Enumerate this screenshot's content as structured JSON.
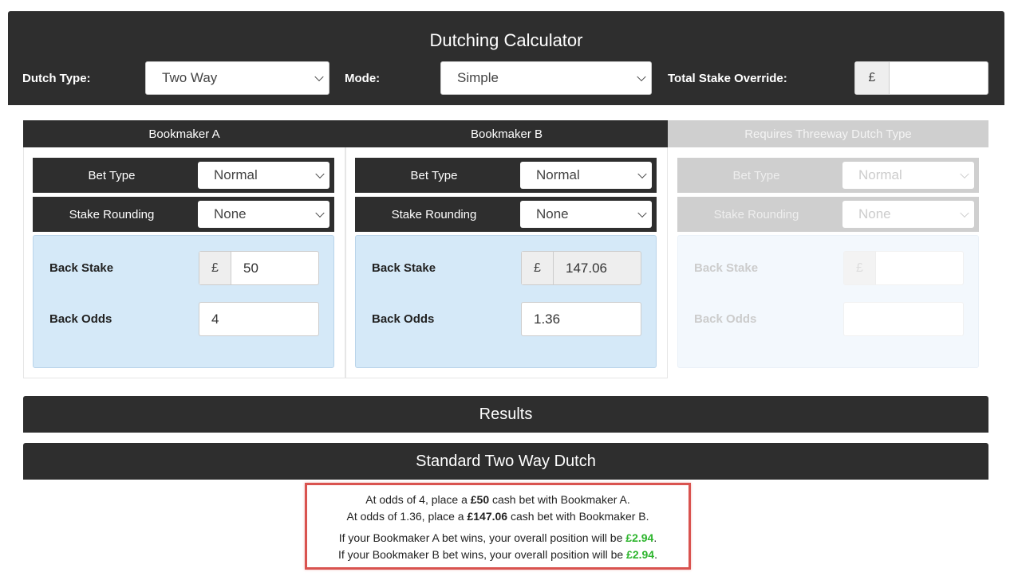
{
  "header": {
    "title": "Dutching Calculator",
    "dutch_type_label": "Dutch Type:",
    "dutch_type_value": "Two Way",
    "mode_label": "Mode:",
    "mode_value": "Simple",
    "override_label": "Total Stake Override:",
    "override_currency": "£",
    "override_value": ""
  },
  "bookmakers": [
    {
      "title": "Bookmaker A",
      "bet_type_label": "Bet Type",
      "bet_type_value": "Normal",
      "rounding_label": "Stake Rounding",
      "rounding_value": "None",
      "stake_label": "Back Stake",
      "currency": "£",
      "stake_value": "50",
      "odds_label": "Back Odds",
      "odds_value": "4"
    },
    {
      "title": "Bookmaker B",
      "bet_type_label": "Bet Type",
      "bet_type_value": "Normal",
      "rounding_label": "Stake Rounding",
      "rounding_value": "None",
      "stake_label": "Back Stake",
      "currency": "£",
      "stake_value": "147.06",
      "odds_label": "Back Odds",
      "odds_value": "1.36"
    },
    {
      "title": "Requires Threeway Dutch Type",
      "bet_type_label": "Bet Type",
      "bet_type_value": "Normal",
      "rounding_label": "Stake Rounding",
      "rounding_value": "None",
      "stake_label": "Back Stake",
      "currency": "£",
      "stake_value": "",
      "odds_label": "Back Odds",
      "odds_value": ""
    }
  ],
  "results": {
    "title": "Results",
    "subtitle": "Standard Two Way Dutch",
    "line1": {
      "pre": "At odds of 4, place a ",
      "amount": "£50",
      "post": " cash bet with Bookmaker A."
    },
    "line2": {
      "pre": "At odds of 1.36, place a ",
      "amount": "£147.06",
      "post": " cash bet with Bookmaker B."
    },
    "line3": {
      "pre": "If your Bookmaker A bet wins, your overall position will be ",
      "amount": "£2.94",
      "post": "."
    },
    "line4": {
      "pre": "If your Bookmaker B bet wins, your overall position will be ",
      "amount": "£2.94",
      "post": "."
    },
    "positive_color": "#2db52d",
    "highlight_border": "#d9534f"
  }
}
